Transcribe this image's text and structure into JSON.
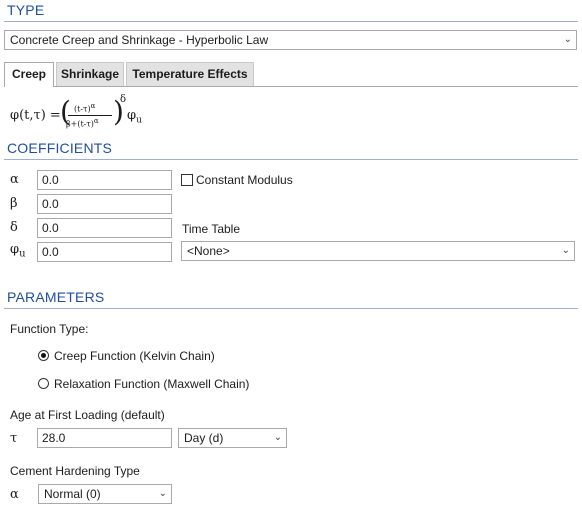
{
  "type_section": {
    "title": "TYPE",
    "selected": "Concrete Creep and Shrinkage - Hyperbolic Law"
  },
  "tabs": [
    {
      "label": "Creep",
      "active": true
    },
    {
      "label": "Shrinkage",
      "active": false
    },
    {
      "label": "Temperature Effects",
      "active": false
    }
  ],
  "formula": {
    "lhs": "φ(t,τ) =",
    "num": "(t-τ)",
    "num_exp": "α",
    "den": "β+(t-τ)",
    "den_exp": "α",
    "outer_exp": "δ",
    "rhs": "φ",
    "rhs_sub": "u"
  },
  "coefficients": {
    "title": "COEFFICIENTS",
    "alpha": {
      "symbol": "α",
      "value": "0.0"
    },
    "beta": {
      "symbol": "β",
      "value": "0.0"
    },
    "delta": {
      "symbol": "δ",
      "value": "0.0"
    },
    "phi_u": {
      "symbol": "φ",
      "sub": "u",
      "value": "0.0"
    },
    "constant_modulus": {
      "label": "Constant Modulus",
      "checked": false
    },
    "time_table": {
      "label": "Time Table",
      "selected": "<None>"
    }
  },
  "parameters": {
    "title": "PARAMETERS",
    "function_type_label": "Function Type:",
    "options": [
      {
        "label": "Creep Function (Kelvin Chain)",
        "selected": true
      },
      {
        "label": "Relaxation Function (Maxwell Chain)",
        "selected": false
      }
    ],
    "age_label": "Age at First Loading (default)",
    "tau_symbol": "τ",
    "tau_value": "28.0",
    "tau_unit": "Day (d)",
    "cement_label": "Cement Hardening Type",
    "cement_symbol": "α",
    "cement_value": "Normal (0)"
  }
}
